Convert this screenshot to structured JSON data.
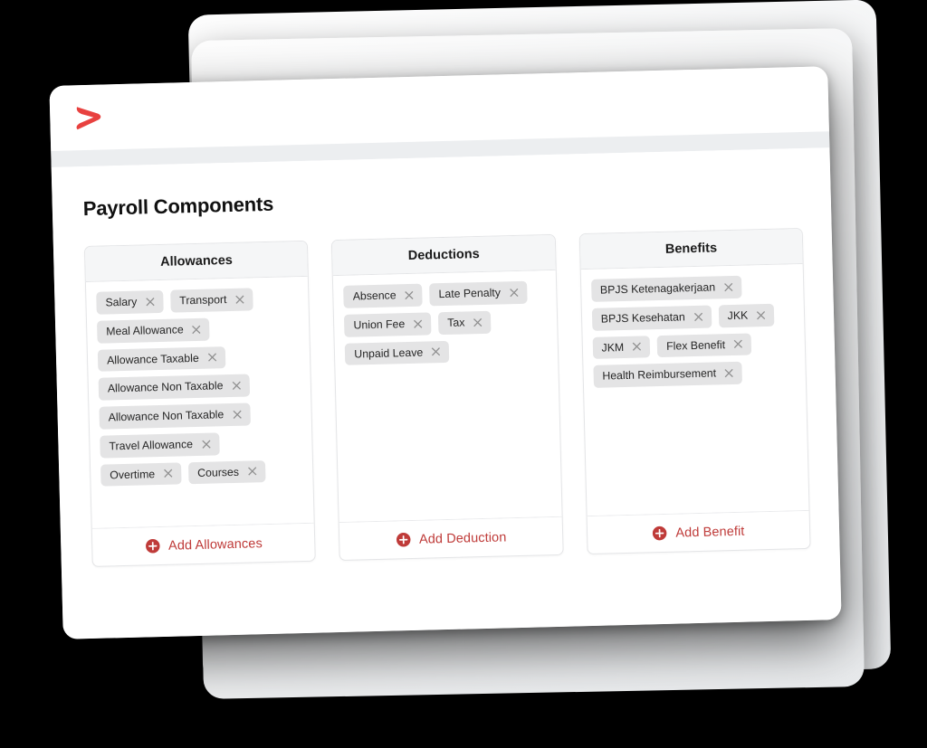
{
  "brand": {
    "logo_icon": "chevron-right-logo",
    "accent_color": "#bf3b39",
    "tag_bg_color": "#e4e4e5",
    "panel_header_bg": "#f5f6f7"
  },
  "page": {
    "title": "Payroll Components"
  },
  "panels": [
    {
      "key": "allowances",
      "header": "Allowances",
      "tags": [
        {
          "label": "Salary"
        },
        {
          "label": "Transport"
        },
        {
          "label": "Meal Allowance"
        },
        {
          "label": "Allowance Taxable"
        },
        {
          "label": "Allowance Non Taxable"
        },
        {
          "label": "Allowance Non Taxable"
        },
        {
          "label": "Travel Allowance"
        },
        {
          "label": "Overtime"
        },
        {
          "label": "Courses"
        }
      ],
      "add_label": "Add Allowances",
      "add_icon": "plus-circle-icon"
    },
    {
      "key": "deductions",
      "header": "Deductions",
      "tags": [
        {
          "label": "Absence"
        },
        {
          "label": "Late Penalty"
        },
        {
          "label": "Union Fee"
        },
        {
          "label": "Tax"
        },
        {
          "label": "Unpaid Leave"
        }
      ],
      "add_label": "Add Deduction",
      "add_icon": "plus-circle-icon"
    },
    {
      "key": "benefits",
      "header": "Benefits",
      "tags": [
        {
          "label": "BPJS Ketenagakerjaan"
        },
        {
          "label": "BPJS Kesehatan"
        },
        {
          "label": "JKK"
        },
        {
          "label": "JKM"
        },
        {
          "label": "Flex Benefit"
        },
        {
          "label": "Health Reimbursement"
        }
      ],
      "add_label": "Add Benefit",
      "add_icon": "plus-circle-icon"
    }
  ]
}
